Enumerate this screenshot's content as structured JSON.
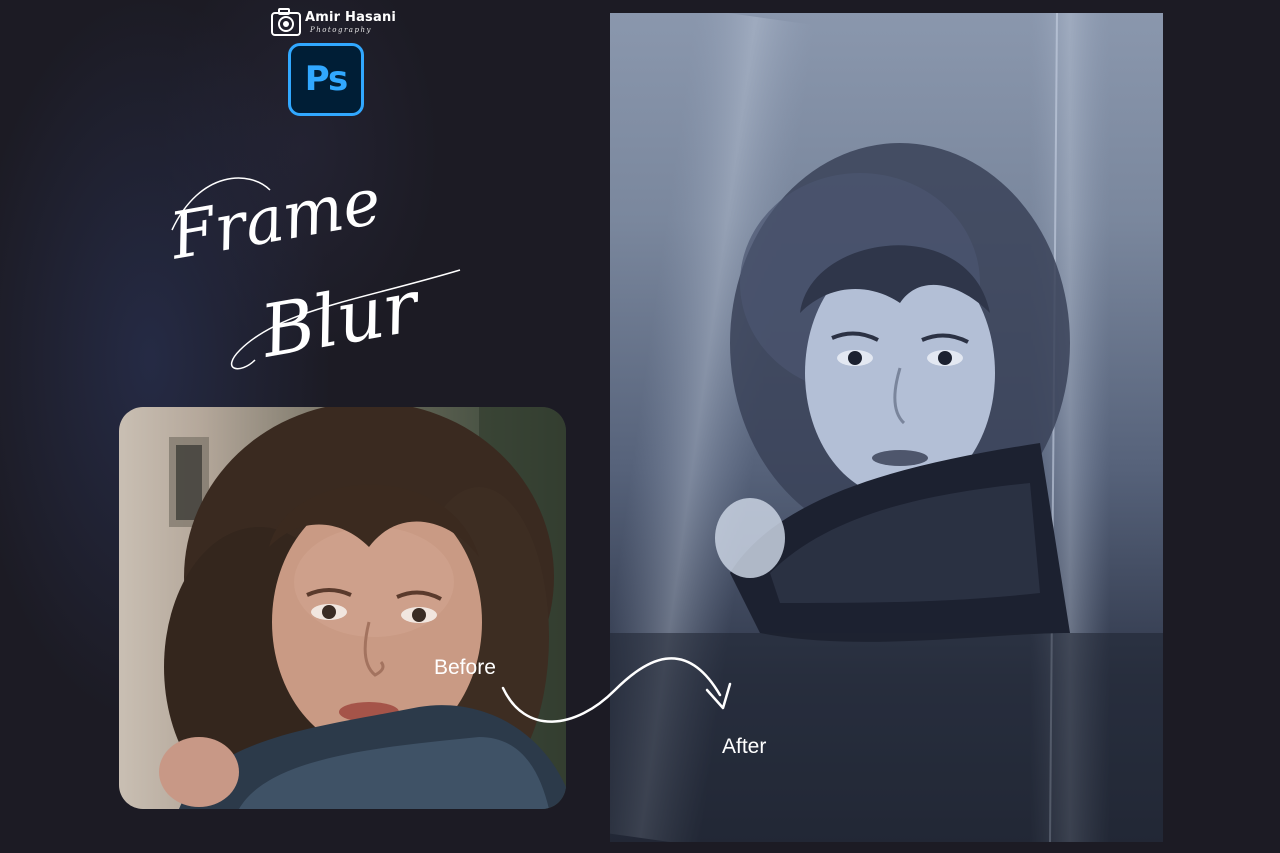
{
  "brand": {
    "name": "Amir Hasani",
    "tagline": "Photography",
    "ps_badge": "Ps",
    "ps_colors": {
      "bg": "#001e36",
      "accent": "#31a8ff"
    }
  },
  "title": {
    "line1": "Frame",
    "line2": "Blur"
  },
  "comparison": {
    "before_label": "Before",
    "after_label": "After"
  },
  "icons": [
    "camera-icon",
    "photoshop-icon",
    "curved-arrow-icon"
  ],
  "colors": {
    "background": "#1c1b24",
    "text": "#ffffff"
  }
}
